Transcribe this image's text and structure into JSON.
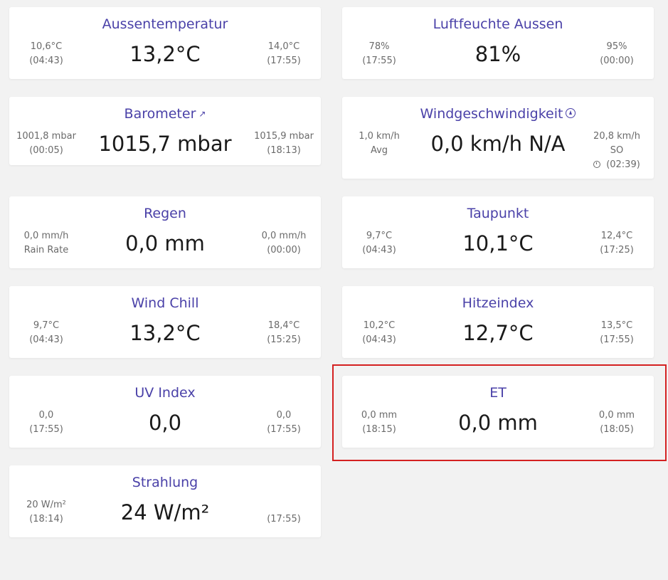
{
  "colors": {
    "title": "#4a41a8",
    "value": "#1a1a1a",
    "sub": "#6a6a6a",
    "card_bg": "#ffffff",
    "page_bg": "#f2f2f2",
    "highlight": "#d42121"
  },
  "cards": {
    "outdoor_temperature": {
      "title": "Aussentemperatur",
      "value": "13,2°C",
      "left": [
        "10,6°C",
        "(04:43)"
      ],
      "right": [
        "14,0°C",
        "(17:55)"
      ]
    },
    "outdoor_humidity": {
      "title": "Luftfeuchte Aussen",
      "value": "81%",
      "left": [
        "78%",
        "(17:55)"
      ],
      "right": [
        "95%",
        "(00:00)"
      ]
    },
    "barometer": {
      "title": "Barometer",
      "title_icon": "external-link-icon",
      "value": "1015,7 mbar",
      "left": [
        "1001,8 mbar",
        "(00:05)"
      ],
      "right": [
        "1015,9 mbar",
        "(18:13)"
      ]
    },
    "wind_speed": {
      "title": "Windgeschwindigkeit",
      "title_icon": "compass-icon",
      "value": "0,0 km/h N/A",
      "left": [
        "1,0 km/h",
        "Avg"
      ],
      "right": [
        "20,8 km/h",
        "SO",
        "(02:39)"
      ],
      "right_time_icon": "clock-icon"
    },
    "rain": {
      "title": "Regen",
      "value": "0,0 mm",
      "left": [
        "0,0 mm/h",
        "Rain Rate"
      ],
      "right": [
        "0,0 mm/h",
        "(00:00)"
      ]
    },
    "dew_point": {
      "title": "Taupunkt",
      "value": "10,1°C",
      "left": [
        "9,7°C",
        "(04:43)"
      ],
      "right": [
        "12,4°C",
        "(17:25)"
      ]
    },
    "wind_chill": {
      "title": "Wind Chill",
      "value": "13,2°C",
      "left": [
        "9,7°C",
        "(04:43)"
      ],
      "right": [
        "18,4°C",
        "(15:25)"
      ]
    },
    "heat_index": {
      "title": "Hitzeindex",
      "value": "12,7°C",
      "left": [
        "10,2°C",
        "(04:43)"
      ],
      "right": [
        "13,5°C",
        "(17:55)"
      ]
    },
    "uv_index": {
      "title": "UV Index",
      "value": "0,0",
      "left": [
        "0,0",
        "(17:55)"
      ],
      "right": [
        "0,0",
        "(17:55)"
      ]
    },
    "et": {
      "title": "ET",
      "value": "0,0 mm",
      "left": [
        "0,0 mm",
        "(18:15)"
      ],
      "right": [
        "0,0 mm",
        "(18:05)"
      ]
    },
    "radiation": {
      "title": "Strahlung",
      "value": "24 W/m²",
      "left": [
        "20 W/m²",
        "(18:14)"
      ],
      "right": [
        "",
        "(17:55)"
      ]
    }
  }
}
